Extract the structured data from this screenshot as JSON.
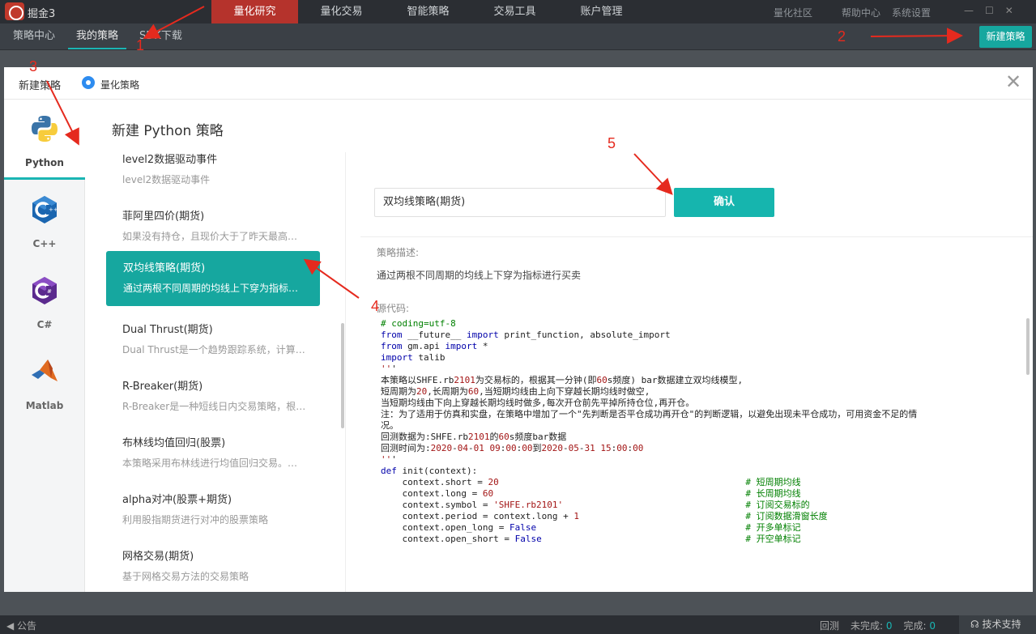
{
  "app": {
    "name": "掘金3"
  },
  "topnav": {
    "items": [
      "量化研究",
      "量化交易",
      "智能策略",
      "交易工具",
      "账户管理"
    ],
    "active_index": 0
  },
  "toplinks": [
    "量化社区",
    "帮助中心",
    "系统设置"
  ],
  "subtabs": {
    "items": [
      "策略中心",
      "我的策略",
      "SDK下载"
    ],
    "active_index": 1
  },
  "top_new_strategy_button": "新建策略",
  "modal": {
    "title": "新建策略",
    "radio_label": "量化策略",
    "close_glyph": "✕",
    "languages": [
      {
        "label": "Python",
        "icon": "python-icon",
        "active": true
      },
      {
        "label": "C++",
        "icon": "cpp-icon"
      },
      {
        "label": "C#",
        "icon": "csharp-icon"
      },
      {
        "label": "Matlab",
        "icon": "matlab-icon"
      }
    ],
    "mid_title": "新建 Python 策略",
    "strategies": [
      {
        "name": "level2数据驱动事件",
        "desc": "level2数据驱动事件"
      },
      {
        "name": "菲阿里四价(期货)",
        "desc": "如果没有持仓，且现价大于了昨天最高价做..."
      },
      {
        "name": "双均线策略(期货)",
        "desc": "通过两根不同周期的均线上下穿为指标进行...",
        "selected": true
      },
      {
        "name": "Dual Thrust(期货)",
        "desc": "Dual Thrust是一个趋势跟踪系统，计算前N..."
      },
      {
        "name": "R-Breaker(期货)",
        "desc": "R-Breaker是一种短线日内交易策略，根据..."
      },
      {
        "name": "布林线均值回归(股票)",
        "desc": "本策略采用布林线进行均值回归交易。当价..."
      },
      {
        "name": "alpha对冲(股票+期货)",
        "desc": "利用股指期货进行对冲的股票策略"
      },
      {
        "name": "网格交易(期货)",
        "desc": "基于网格交易方法的交易策略"
      }
    ],
    "strategy_name_value": "双均线策略(期货)",
    "confirm_button": "确认",
    "desc_label": "策略描述:",
    "desc_text": "通过两根不同周期的均线上下穿为指标进行买卖",
    "code_label": "源代码:",
    "code_lines": [
      "# coding=utf-8",
      "from __future__ import print_function, absolute_import",
      "from gm.api import *",
      "import talib",
      "",
      "",
      "'''",
      "本策略以SHFE.rb2101为交易标的，根据其一分钟(即60s频度) bar数据建立双均线模型,",
      "短周期为20,长周期为60,当短期均线由上向下穿越长期均线时做空,",
      "当短期均线由下向上穿越长期均线时做多,每次开仓前先平掉所持仓位,再开仓。",
      "注：为了适用于仿真和实盘，在策略中增加了一个\"先判断是否平仓成功再开仓\"的判断逻辑，以避免出现未平仓成功，可用资金不足的情",
      "况。",
      "回测数据为:SHFE.rb2101的60s频度bar数据",
      "回测时间为:2020-04-01 09:00:00到2020-05-31 15:00:00",
      "'''",
      "",
      "",
      "def init(context):",
      "    context.short = 20                                              # 短周期均线",
      "    context.long = 60                                               # 长周期均线",
      "    context.symbol = 'SHFE.rb2101'                                  # 订阅交易标的",
      "    context.period = context.long + 1                               # 订阅数据滑窗长度",
      "    context.open_long = False                                       # 开多单标记",
      "    context.open_short = False                                      # 开空单标记"
    ]
  },
  "annotations": [
    "1",
    "2",
    "3",
    "4",
    "5"
  ],
  "statusbar": {
    "notice": "公告",
    "backtest": "回测",
    "unfinished_label": "未完成:",
    "unfinished_value": "0",
    "finished_label": "完成:",
    "finished_value": "0",
    "support": "技术支持"
  },
  "colors": {
    "accent": "#16a79f",
    "active_nav": "#b5332c",
    "annotation": "#e52a1e"
  }
}
